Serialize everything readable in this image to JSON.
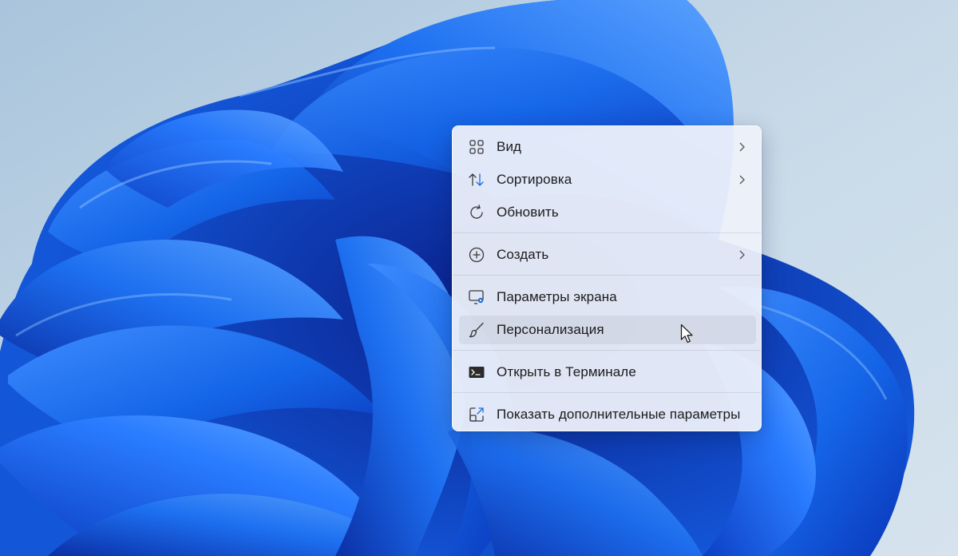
{
  "desktop": {
    "wallpaper": "windows-11-bloom",
    "colors": {
      "background": "#b9cfe0",
      "bloom_primary": "#1565e8",
      "bloom_dark": "#0a2fb0"
    }
  },
  "context_menu": {
    "items": [
      {
        "label": "Вид",
        "icon": "grid-icon",
        "has_submenu": true
      },
      {
        "label": "Сортировка",
        "icon": "sort-arrows-icon",
        "has_submenu": true
      },
      {
        "label": "Обновить",
        "icon": "refresh-icon",
        "has_submenu": false
      },
      {
        "label": "Создать",
        "icon": "add-circle-icon",
        "has_submenu": true
      },
      {
        "label": "Параметры экрана",
        "icon": "display-settings-icon",
        "has_submenu": false
      },
      {
        "label": "Персонализация",
        "icon": "brush-icon",
        "has_submenu": false,
        "hovered": true
      },
      {
        "label": "Открыть в Терминале",
        "icon": "terminal-icon",
        "has_submenu": false
      },
      {
        "label": "Показать дополнительные параметры",
        "icon": "expand-icon",
        "has_submenu": false
      }
    ]
  }
}
